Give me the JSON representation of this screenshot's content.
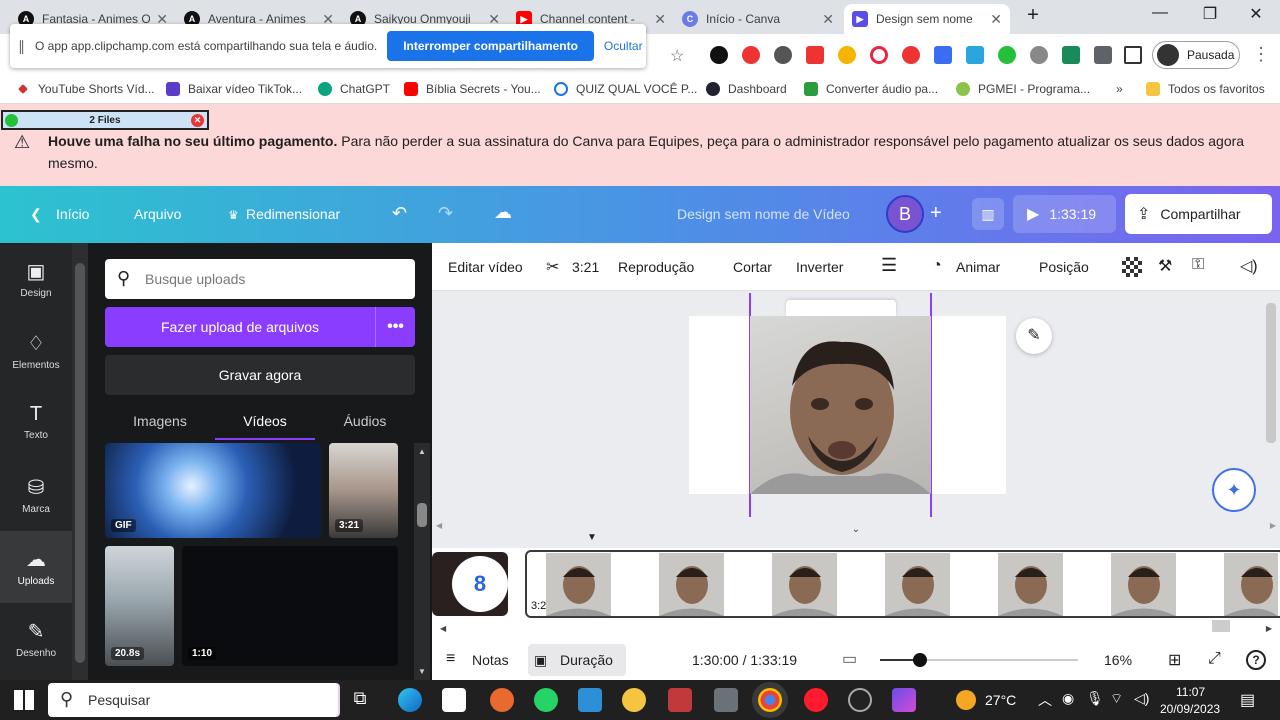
{
  "browser": {
    "tabs": [
      {
        "label": "Fantasia - Animes O",
        "icon": "A"
      },
      {
        "label": "Aventura - Animes",
        "icon": "A"
      },
      {
        "label": "Saikyou Onmyouji",
        "icon": "A"
      },
      {
        "label": "Channel content -",
        "icon": "▶"
      },
      {
        "label": "Início - Canva",
        "icon": "C"
      },
      {
        "label": "Design sem nome",
        "icon": "▶"
      }
    ],
    "share_notice": "O app app.clipchamp.com está compartilhando sua tela e áudio.",
    "stop_share": "Interromper compartilhamento",
    "hide": "Ocultar",
    "profile_label": "Pausada",
    "bookmarks": [
      "YouTube Shorts Víd...",
      "Baixar vídeo TikTok...",
      "ChatGPT",
      "Bíblia Secrets - You...",
      "QUIZ QUAL VOCÊ P...",
      "Dashboard",
      "Converter áudio pa...",
      "PGMEI - Programa..."
    ],
    "more_bookmarks": "»",
    "all_bookmarks": "Todos os favoritos"
  },
  "files_widget": "2 Files",
  "alert": {
    "bold": "Houve uma falha no seu último pagamento.",
    "text": " Para não perder a sua assinatura do Canva para Equipes, peça para o administrador responsável pelo pagamento atualizar os seus dados agora mesmo."
  },
  "header": {
    "home": "Início",
    "file": "Arquivo",
    "resize": "Redimensionar",
    "title": "Design sem nome de Vídeo",
    "avatar_letter": "B",
    "play_time": "1:33:19",
    "share": "Compartilhar"
  },
  "rail": [
    {
      "label": "Design",
      "icon": "▣"
    },
    {
      "label": "Elementos",
      "icon": "♢"
    },
    {
      "label": "Texto",
      "icon": "T"
    },
    {
      "label": "Marca",
      "icon": "⛁"
    },
    {
      "label": "Uploads",
      "icon": "☁"
    },
    {
      "label": "Desenho",
      "icon": "✎"
    }
  ],
  "panel": {
    "search_placeholder": "Busque uploads",
    "upload_button": "Fazer upload de arquivos",
    "more": "•••",
    "record_button": "Gravar agora",
    "tabs": [
      "Imagens",
      "Vídeos",
      "Áudios"
    ],
    "thumbs": [
      {
        "badge": "GIF"
      },
      {
        "badge": "3:21"
      },
      {
        "badge": "20.8s"
      },
      {
        "badge": "1:10"
      }
    ]
  },
  "edit_toolbar": {
    "edit_video": "Editar vídeo",
    "duration": "3:21",
    "playback": "Reprodução",
    "crop": "Cortar",
    "flip": "Inverter",
    "animate": "Animar",
    "position": "Posição"
  },
  "timeline": {
    "clip_time": "3:21"
  },
  "bottom": {
    "notes": "Notas",
    "duration": "Duração",
    "time": "1:30:00 / 1:33:19",
    "zoom": "16%",
    "zoom_level": 0.2
  },
  "taskbar": {
    "search": "Pesquisar",
    "temp": "27°C",
    "time": "11:07",
    "date": "20/09/2023"
  }
}
